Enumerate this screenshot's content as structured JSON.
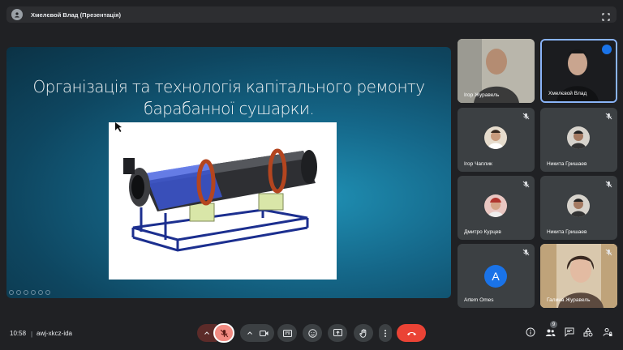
{
  "header": {
    "title": "Хмелєвой Влад (Презентація)"
  },
  "slide": {
    "title_line1": "Організація та технологія капітального ремонту",
    "title_line2": "барабанної сушарки."
  },
  "participants": [
    {
      "name": "Ігор Журавель",
      "muted": false,
      "video": true
    },
    {
      "name": "Хмелєвой Влад",
      "muted": false,
      "video": true,
      "speaking": true
    },
    {
      "name": "Ігор Чаплик",
      "muted": true,
      "video": false
    },
    {
      "name": "Никита Гришаев",
      "muted": true,
      "video": false
    },
    {
      "name": "Дмитро Курцев",
      "muted": true,
      "video": false
    },
    {
      "name": "Никита Гришаев",
      "muted": true,
      "video": false
    },
    {
      "name": "Artem Omes",
      "muted": true,
      "video": false,
      "initial": "A",
      "color": "#1a73e8"
    },
    {
      "name": "Галина Журавель",
      "muted": true,
      "video": true
    }
  ],
  "bottom_bar": {
    "time": "10:58",
    "separator": "|",
    "meeting_code": "awj-xkcz-ida",
    "participants_count": "9"
  },
  "colors": {
    "background": "#202124",
    "tile": "#3c4043",
    "end_call": "#ea4335",
    "mic_muted": "#f28b82",
    "accent": "#8ab4f8"
  }
}
